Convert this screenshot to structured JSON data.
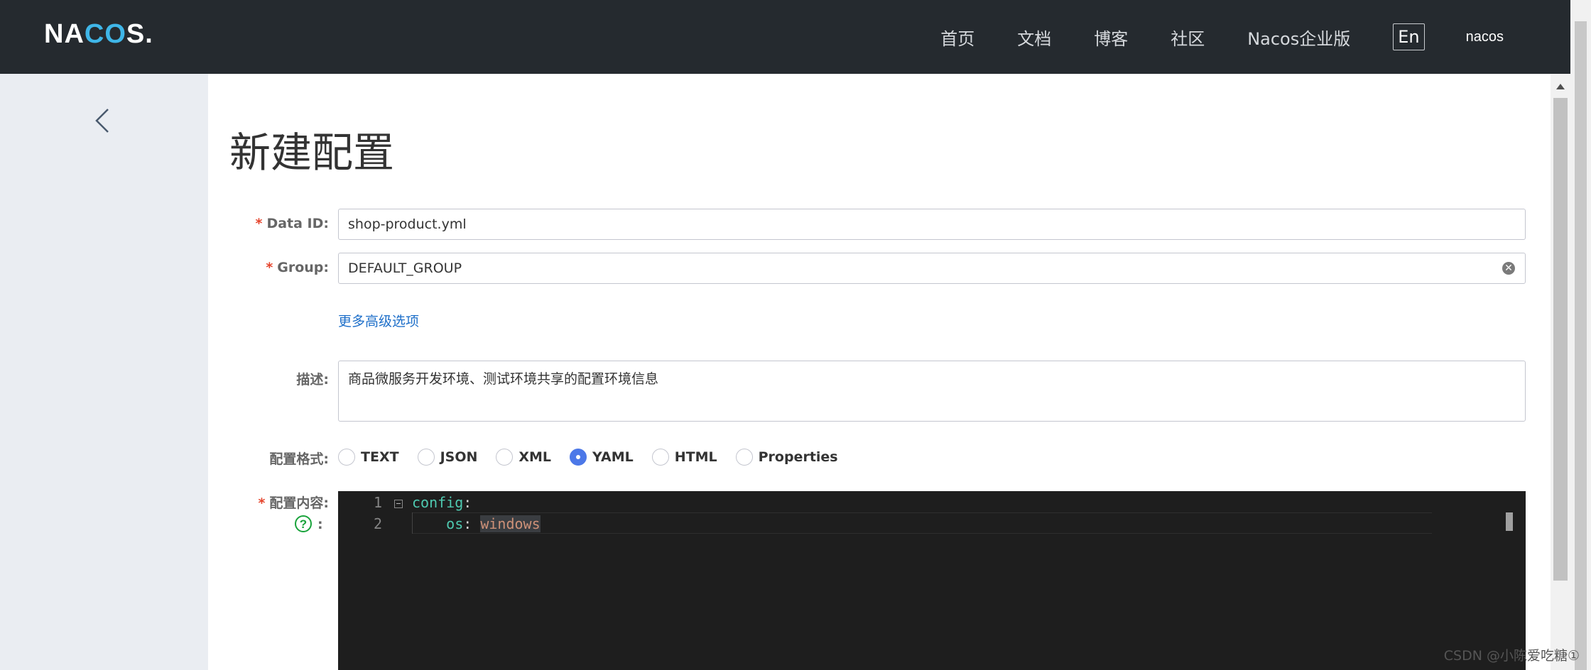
{
  "header": {
    "logo_na": "NA",
    "logo_co": "CO",
    "logo_s": "S.",
    "nav": [
      "首页",
      "文档",
      "博客",
      "社区",
      "Nacos企业版"
    ],
    "lang": "En",
    "user": "nacos"
  },
  "page": {
    "title": "新建配置"
  },
  "form": {
    "required_mark": "*",
    "data_id_label": "Data ID:",
    "data_id_value": "shop-product.yml",
    "group_label": "Group:",
    "group_value": "DEFAULT_GROUP",
    "advanced_link": "更多高级选项",
    "desc_label": "描述:",
    "desc_value": "商品微服务开发环境、测试环境共享的配置环境信息",
    "format_label": "配置格式:",
    "formats": [
      "TEXT",
      "JSON",
      "XML",
      "YAML",
      "HTML",
      "Properties"
    ],
    "selected_format": "YAML",
    "content_label": "配置内容:",
    "help_colon": ":"
  },
  "editor": {
    "line_numbers": [
      "1",
      "2"
    ],
    "line1_key": "config",
    "line1_colon": ":",
    "line2_key": "    os",
    "line2_colon": ": ",
    "line2_value": "windows"
  },
  "watermark": "CSDN @小陈爱吃糖①"
}
